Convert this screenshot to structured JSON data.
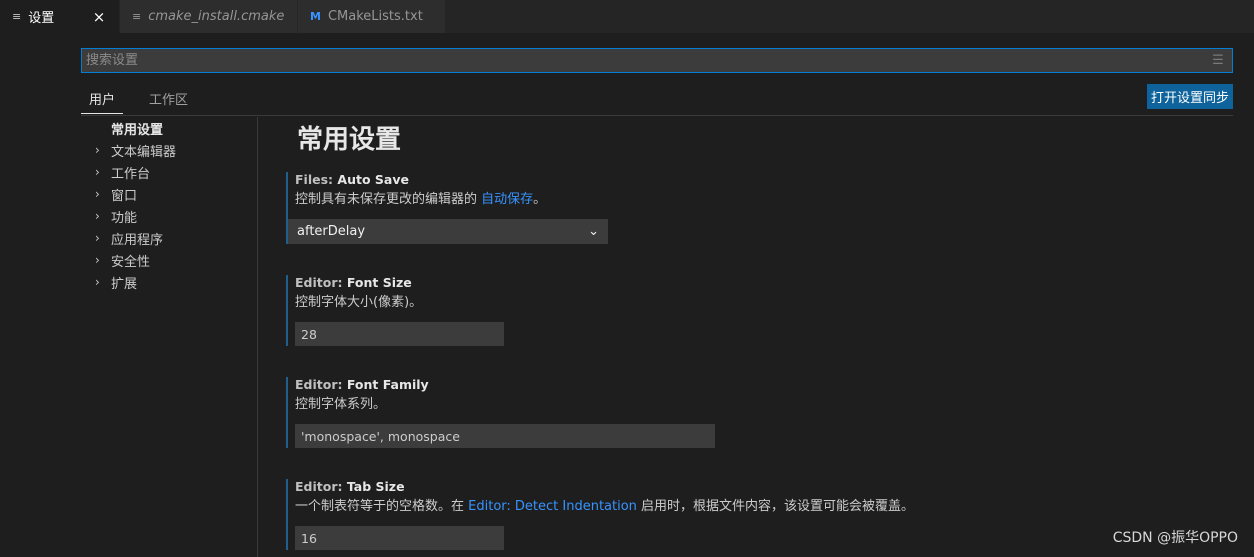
{
  "tabs": [
    {
      "icon": "≡",
      "label": "设置",
      "close": "×"
    },
    {
      "icon": "≡",
      "label": "cmake_install.cmake"
    },
    {
      "icon": "M",
      "label": "CMakeLists.txt"
    }
  ],
  "search": {
    "placeholder": "搜索设置"
  },
  "scope_tabs": [
    "用户",
    "工作区"
  ],
  "sync_button": "打开设置同步",
  "toc": {
    "selected": "常用设置",
    "items": [
      "文本编辑器",
      "工作台",
      "窗口",
      "功能",
      "应用程序",
      "安全性",
      "扩展"
    ]
  },
  "section_title": "常用设置",
  "settings": {
    "auto_save": {
      "category": "Files: ",
      "name": "Auto Save",
      "desc_prefix": "控制具有未保存更改的编辑器的 ",
      "desc_link": "自动保存",
      "desc_suffix": "。",
      "value": "afterDelay"
    },
    "font_size": {
      "category": "Editor: ",
      "name": "Font Size",
      "desc": "控制字体大小(像素)。",
      "value": "28"
    },
    "font_family": {
      "category": "Editor: ",
      "name": "Font Family",
      "desc": "控制字体系列。",
      "value": "'monospace', monospace"
    },
    "tab_size": {
      "category": "Editor: ",
      "name": "Tab Size",
      "desc_prefix": "一个制表符等于的空格数。在 ",
      "desc_link": "Editor: Detect Indentation",
      "desc_suffix": " 启用时，根据文件内容，该设置可能会被覆盖。",
      "value": "16"
    }
  },
  "watermark": "CSDN @振华OPPO",
  "colors": {
    "accent": "#007fd4",
    "button": "#0e639c",
    "link": "#3794ff",
    "modified_bar": "#1f5f8c"
  }
}
